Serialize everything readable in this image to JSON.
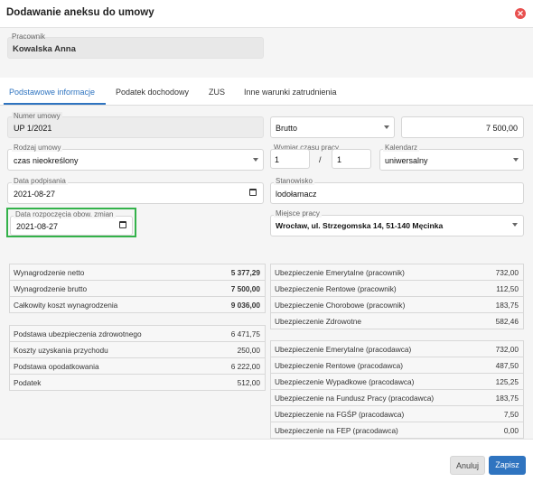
{
  "dialog": {
    "title": "Dodawanie aneksu do umowy",
    "close_icon": "close-icon"
  },
  "employee": {
    "label": "Pracownik",
    "value": "Kowalska Anna"
  },
  "tabs": [
    {
      "label": "Podstawowe informacje",
      "active": true
    },
    {
      "label": "Podatek dochodowy",
      "active": false
    },
    {
      "label": "ZUS",
      "active": false
    },
    {
      "label": "Inne warunki zatrudnienia",
      "active": false
    }
  ],
  "form": {
    "contract_number": {
      "label": "Numer umowy",
      "value": "UP 1/2021"
    },
    "salary_type": {
      "value": "Brutto"
    },
    "salary_amount": {
      "value": "7 500,00"
    },
    "contract_type": {
      "label": "Rodzaj umowy",
      "value": "czas nieokreślony"
    },
    "working_time": {
      "label": "Wymiar czasu pracy",
      "numerator": "1",
      "separator": "/",
      "denominator": "1"
    },
    "calendar": {
      "label": "Kalendarz",
      "value": "uniwersalny"
    },
    "sign_date": {
      "label": "Data podpisania",
      "value": "2021-08-27"
    },
    "position": {
      "label": "Stanowisko",
      "value": "lodołamacz"
    },
    "change_start_date": {
      "label": "Data rozpoczęcia obow. zmian",
      "value": "2021-08-27"
    },
    "workplace": {
      "label": "Miejsce pracy",
      "value": "Wrocław, ul. Strzegomska 14, 51-140 Męcinka"
    }
  },
  "summary_left_1": [
    {
      "label": "Wynagrodzenie netto",
      "value": "5 377,29"
    },
    {
      "label": "Wynagrodzenie brutto",
      "value": "7 500,00"
    },
    {
      "label": "Całkowity koszt wynagrodzenia",
      "value": "9 036,00"
    }
  ],
  "summary_left_2": [
    {
      "label": "Podstawa ubezpieczenia zdrowotnego",
      "value": "6 471,75"
    },
    {
      "label": "Koszty uzyskania przychodu",
      "value": "250,00"
    },
    {
      "label": "Podstawa opodatkowania",
      "value": "6 222,00"
    },
    {
      "label": "Podatek",
      "value": "512,00"
    }
  ],
  "summary_right_1": [
    {
      "label": "Ubezpieczenie Emerytalne (pracownik)",
      "value": "732,00"
    },
    {
      "label": "Ubezpieczenie Rentowe (pracownik)",
      "value": "112,50"
    },
    {
      "label": "Ubezpieczenie Chorobowe (pracownik)",
      "value": "183,75"
    },
    {
      "label": "Ubezpieczenie Zdrowotne",
      "value": "582,46"
    }
  ],
  "summary_right_2": [
    {
      "label": "Ubezpieczenie Emerytalne (pracodawca)",
      "value": "732,00"
    },
    {
      "label": "Ubezpieczenie Rentowe (pracodawca)",
      "value": "487,50"
    },
    {
      "label": "Ubezpieczenie Wypadkowe (pracodawca)",
      "value": "125,25"
    },
    {
      "label": "Ubezpieczenie na Fundusz Pracy (pracodawca)",
      "value": "183,75"
    },
    {
      "label": "Ubezpieczenie na FGŚP (pracodawca)",
      "value": "7,50"
    },
    {
      "label": "Ubezpieczenie na FEP (pracodawca)",
      "value": "0,00"
    }
  ],
  "footer": {
    "cancel_label": "Anuluj",
    "save_label": "Zapisz"
  }
}
